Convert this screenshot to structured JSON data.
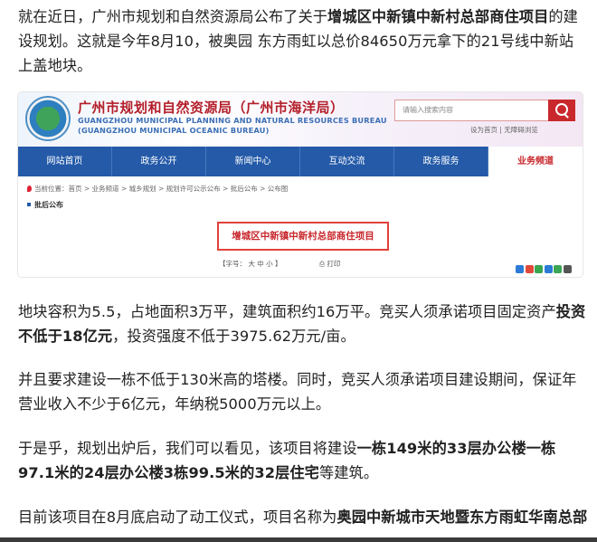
{
  "article": {
    "p1": {
      "a": "就在近日，广州市规划和自然资源局公布了关于",
      "b": "增城区中新镇中新村总部商住项目",
      "c": "的建设规划。这就是今年8月10，被奥园 东方雨虹以总价84650万元拿下的21号线中新站上盖地块。"
    },
    "p2": {
      "a": "地块容积为5.5，占地面积3万平，建筑面积约16万平。竞买人须承诺项目固定资产",
      "b": "投资不低于18亿元",
      "c": "，投资强度不低于3975.62万元/亩。"
    },
    "p3": "并且要求建设一栋不低于130米高的塔楼。同时，竞买人须承诺项目建设期间，保证年营业收入不少于6亿元，年纳税5000万元以上。",
    "p4": {
      "a": "于是乎，规划出炉后，我们可以看见，该项目将建设",
      "b": "一栋149米的33层办公楼一栋97.1米的24层办公楼3栋99.5米的32层住宅",
      "c": "等建筑。"
    },
    "p5": {
      "a": "目前该项目在8月底启动了动工仪式，项目名称为",
      "b": "奥园中新城市天地暨东方雨虹华南总部"
    }
  },
  "screenshot": {
    "org_cn": "广州市规划和自然资源局（广州市海洋局）",
    "org_en1": "GUANGZHOU MUNICIPAL PLANNING AND NATURAL RESOURCES BUREAU",
    "org_en2": "(GUANGZHOU MUNICIPAL OCEANIC BUREAU)",
    "search_placeholder": "请输入搜索内容",
    "sub_links": "设为首页 | 无障碍浏览",
    "nav": [
      "网站首页",
      "政务公开",
      "新闻中心",
      "互动交流",
      "政务服务",
      "业务频道"
    ],
    "active_nav": 5,
    "breadcrumb": "当前位置：首页 > 业务频道 > 城乡规划 > 规划许可公示公布 > 批后公布 > 公布图",
    "section": "批后公布",
    "highlight_title": "增城区中新镇中新村总部商住项目",
    "font_ctrl": "【字号： 大  中  小 】",
    "print": "打印",
    "colors": {
      "nav_bg": "#245aa8",
      "accent_red": "#c9282d"
    }
  }
}
